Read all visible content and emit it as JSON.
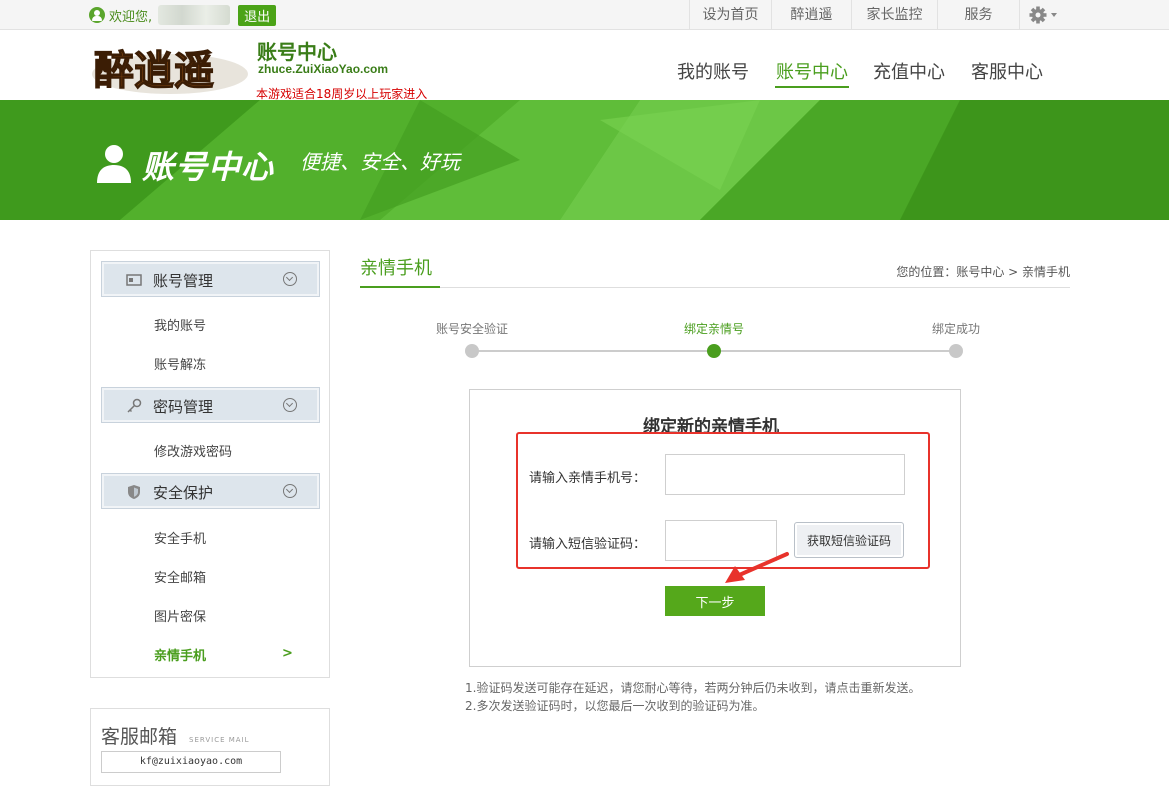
{
  "topbar": {
    "welcome": "欢迎您,",
    "logout": "退出",
    "links": [
      "设为首页",
      "醉逍遥",
      "家长监控",
      "服务"
    ]
  },
  "header": {
    "logo_text": "醉逍遥",
    "title": "账号中心",
    "url": "zhuce.ZuiXiaoYao.com",
    "age_notice": "本游戏适合18周岁以上玩家进入",
    "nav": [
      "我的账号",
      "账号中心",
      "充值中心",
      "客服中心"
    ]
  },
  "banner": {
    "title": "账号中心",
    "slogan": "便捷、安全、好玩"
  },
  "sidebar": {
    "groups": [
      {
        "label": "账号管理",
        "items": [
          "我的账号",
          "账号解冻"
        ]
      },
      {
        "label": "密码管理",
        "items": [
          "修改游戏密码"
        ]
      },
      {
        "label": "安全保护",
        "items": [
          "安全手机",
          "安全邮箱",
          "图片密保",
          "亲情手机"
        ]
      }
    ],
    "active_arrow": ">"
  },
  "mail": {
    "title": "客服邮箱",
    "subtitle": "SERVICE MAIL",
    "address": "kf@zuixiaoyao.com"
  },
  "main": {
    "title": "亲情手机",
    "breadcrumb": "您的位置：账号中心 > 亲情手机",
    "steps": [
      "账号安全验证",
      "绑定亲情号",
      "绑定成功"
    ],
    "current_step": 2
  },
  "form": {
    "title": "绑定新的亲情手机",
    "phone_label": "请输入亲情手机号：",
    "code_label": "请输入短信验证码：",
    "phone_value": "",
    "code_value": "",
    "sms_button": "获取短信验证码",
    "next_button": "下一步"
  },
  "notes": [
    "1.验证码发送可能存在延迟，请您耐心等待，若两分钟后仍未收到，请点击重新发送。",
    "2.多次发送验证码时，以您最后一次收到的验证码为准。"
  ],
  "colors": {
    "brand_green": "#4a9e1e",
    "highlight_red": "#e8322b"
  }
}
